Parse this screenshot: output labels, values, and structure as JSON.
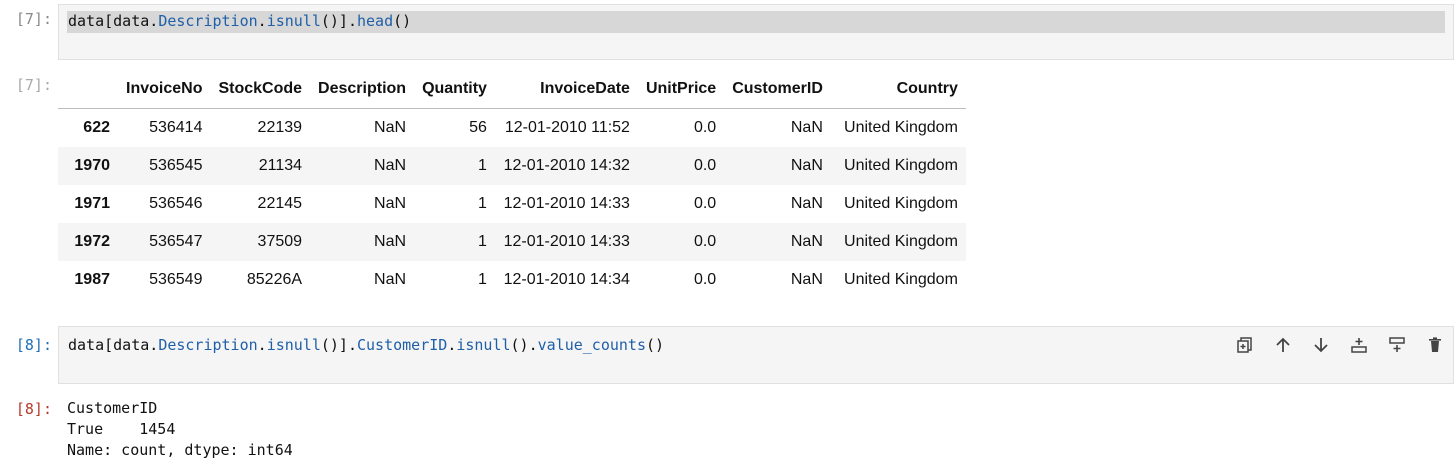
{
  "cell7": {
    "prompt_in": "[7]:",
    "prompt_out": "[7]:",
    "code": {
      "sel_a": "data[data.",
      "sel_b": "Description",
      "sel_c": ".",
      "sel_d": "isnull",
      "sel_e": "()].",
      "sel_f": "head",
      "sel_g": "()"
    },
    "table": {
      "columns": [
        "",
        "InvoiceNo",
        "StockCode",
        "Description",
        "Quantity",
        "InvoiceDate",
        "UnitPrice",
        "CustomerID",
        "Country"
      ],
      "rows": [
        [
          "622",
          "536414",
          "22139",
          "NaN",
          "56",
          "12-01-2010 11:52",
          "0.0",
          "NaN",
          "United Kingdom"
        ],
        [
          "1970",
          "536545",
          "21134",
          "NaN",
          "1",
          "12-01-2010 14:32",
          "0.0",
          "NaN",
          "United Kingdom"
        ],
        [
          "1971",
          "536546",
          "22145",
          "NaN",
          "1",
          "12-01-2010 14:33",
          "0.0",
          "NaN",
          "United Kingdom"
        ],
        [
          "1972",
          "536547",
          "37509",
          "NaN",
          "1",
          "12-01-2010 14:33",
          "0.0",
          "NaN",
          "United Kingdom"
        ],
        [
          "1987",
          "536549",
          "85226A",
          "NaN",
          "1",
          "12-01-2010 14:34",
          "0.0",
          "NaN",
          "United Kingdom"
        ]
      ]
    }
  },
  "cell8": {
    "prompt_in": "[8]:",
    "prompt_out": "[8]:",
    "code": {
      "a": "data[data.",
      "b": "Description",
      "c": ".",
      "d": "isnull",
      "e": "()].",
      "f": "CustomerID",
      "g": ".",
      "h": "isnull",
      "i": "().",
      "j": "value_counts",
      "k": "()"
    },
    "toolbar_icons": [
      "duplicate-icon",
      "move-up-icon",
      "move-down-icon",
      "insert-above-icon",
      "insert-below-icon",
      "delete-icon"
    ],
    "output_lines": [
      "CustomerID",
      "True    1454",
      "Name: count, dtype: int64"
    ]
  }
}
